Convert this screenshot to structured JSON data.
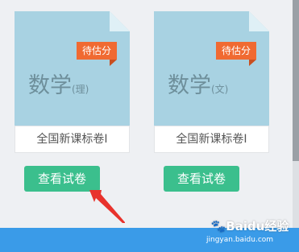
{
  "cards": [
    {
      "badge": "待估分",
      "subject": "数学",
      "subject_sub": "(理)",
      "paper": "全国新课标卷I",
      "button": "查看试卷"
    },
    {
      "badge": "待估分",
      "subject": "数学",
      "subject_sub": "(文)",
      "paper": "全国新课标卷I",
      "button": "查看试卷"
    }
  ],
  "watermark": {
    "logo": "Baidu经验",
    "url": "jingyan.baidu.com"
  },
  "colors": {
    "doc": "#a8d2e2",
    "badge": "#f06a32",
    "button": "#3bbf8d",
    "arrow": "#e8322c",
    "footer": "#3a9be8"
  },
  "icons": [
    "red-arrow-pointer-icon",
    "paw-logo-icon"
  ]
}
